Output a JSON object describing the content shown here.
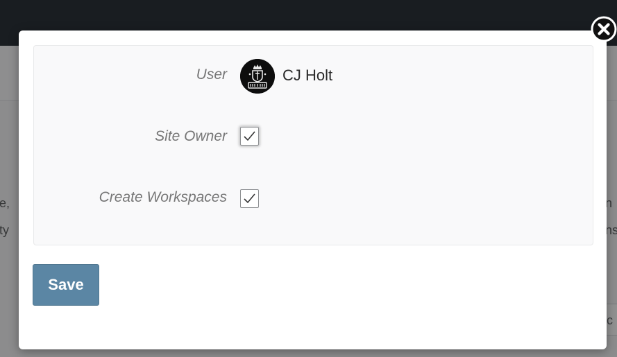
{
  "background": {
    "left_snippets": [
      "e,",
      "ty"
    ],
    "right_snippets": [
      "n",
      "ns"
    ],
    "box_snippet": "nc"
  },
  "dialog": {
    "close_icon": "close-circle-icon",
    "fields": {
      "user": {
        "label": "User",
        "avatar_icon": "avatar-crest-icon",
        "name": "CJ Holt"
      },
      "site_owner": {
        "label": "Site Owner",
        "checked": true
      },
      "create_workspaces": {
        "label": "Create Workspaces",
        "checked": true
      }
    },
    "save_label": "Save"
  },
  "colors": {
    "primary_button": "#5b86a4",
    "modal_bg": "#ffffff",
    "panel_bg": "#f9f9fa",
    "topbar": "#2c333a"
  }
}
